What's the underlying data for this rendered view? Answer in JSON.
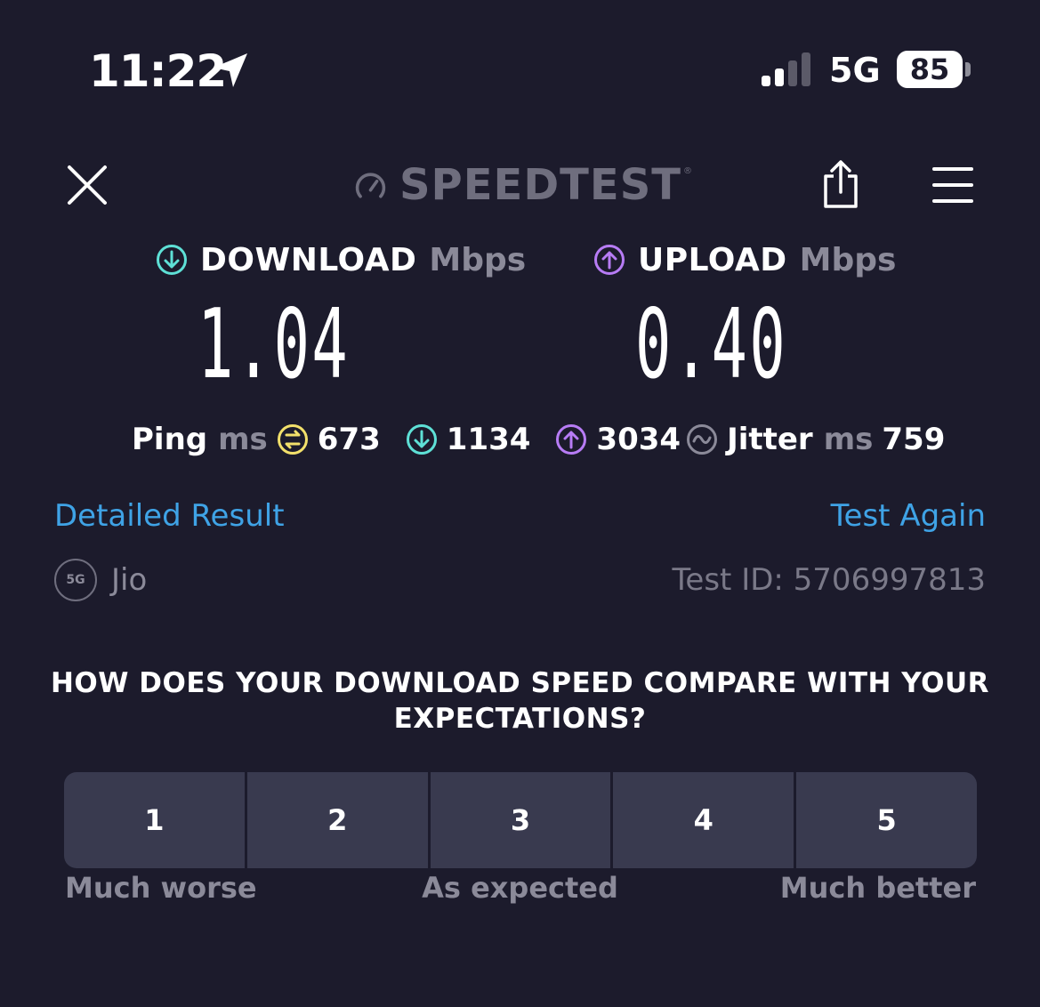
{
  "status_bar": {
    "time": "11:22",
    "location_icon": "location-arrow-icon",
    "network": "5G",
    "battery": "85"
  },
  "header": {
    "logo_text": "SPEEDTEST",
    "logo_tm": "®",
    "close_icon": "close-icon",
    "share_icon": "share-icon",
    "menu_icon": "menu-icon"
  },
  "results": {
    "download": {
      "label": "DOWNLOAD",
      "unit": "Mbps",
      "value": "1.04",
      "color": "#5ee0d6"
    },
    "upload": {
      "label": "UPLOAD",
      "unit": "Mbps",
      "value": "0.40",
      "color": "#b77cf5"
    }
  },
  "ping": {
    "label": "Ping",
    "unit": "ms",
    "idle": "673",
    "download": "1134",
    "upload": "3034",
    "jitter_label": "Jitter",
    "jitter_unit": "ms",
    "jitter": "759",
    "idle_color": "#f2e06b"
  },
  "links": {
    "detailed_result": "Detailed Result",
    "test_again": "Test Again"
  },
  "provider": {
    "badge": "5G",
    "name": "Jio",
    "test_id": "Test ID: 5706997813"
  },
  "survey": {
    "question": "HOW DOES YOUR DOWNLOAD SPEED COMPARE WITH YOUR EXPECTATIONS?",
    "options": [
      "1",
      "2",
      "3",
      "4",
      "5"
    ],
    "scale_low": "Much worse",
    "scale_mid": "As expected",
    "scale_high": "Much better"
  },
  "colors": {
    "background": "#1c1b2c",
    "link": "#3fa3e6",
    "button": "#393a4f"
  }
}
